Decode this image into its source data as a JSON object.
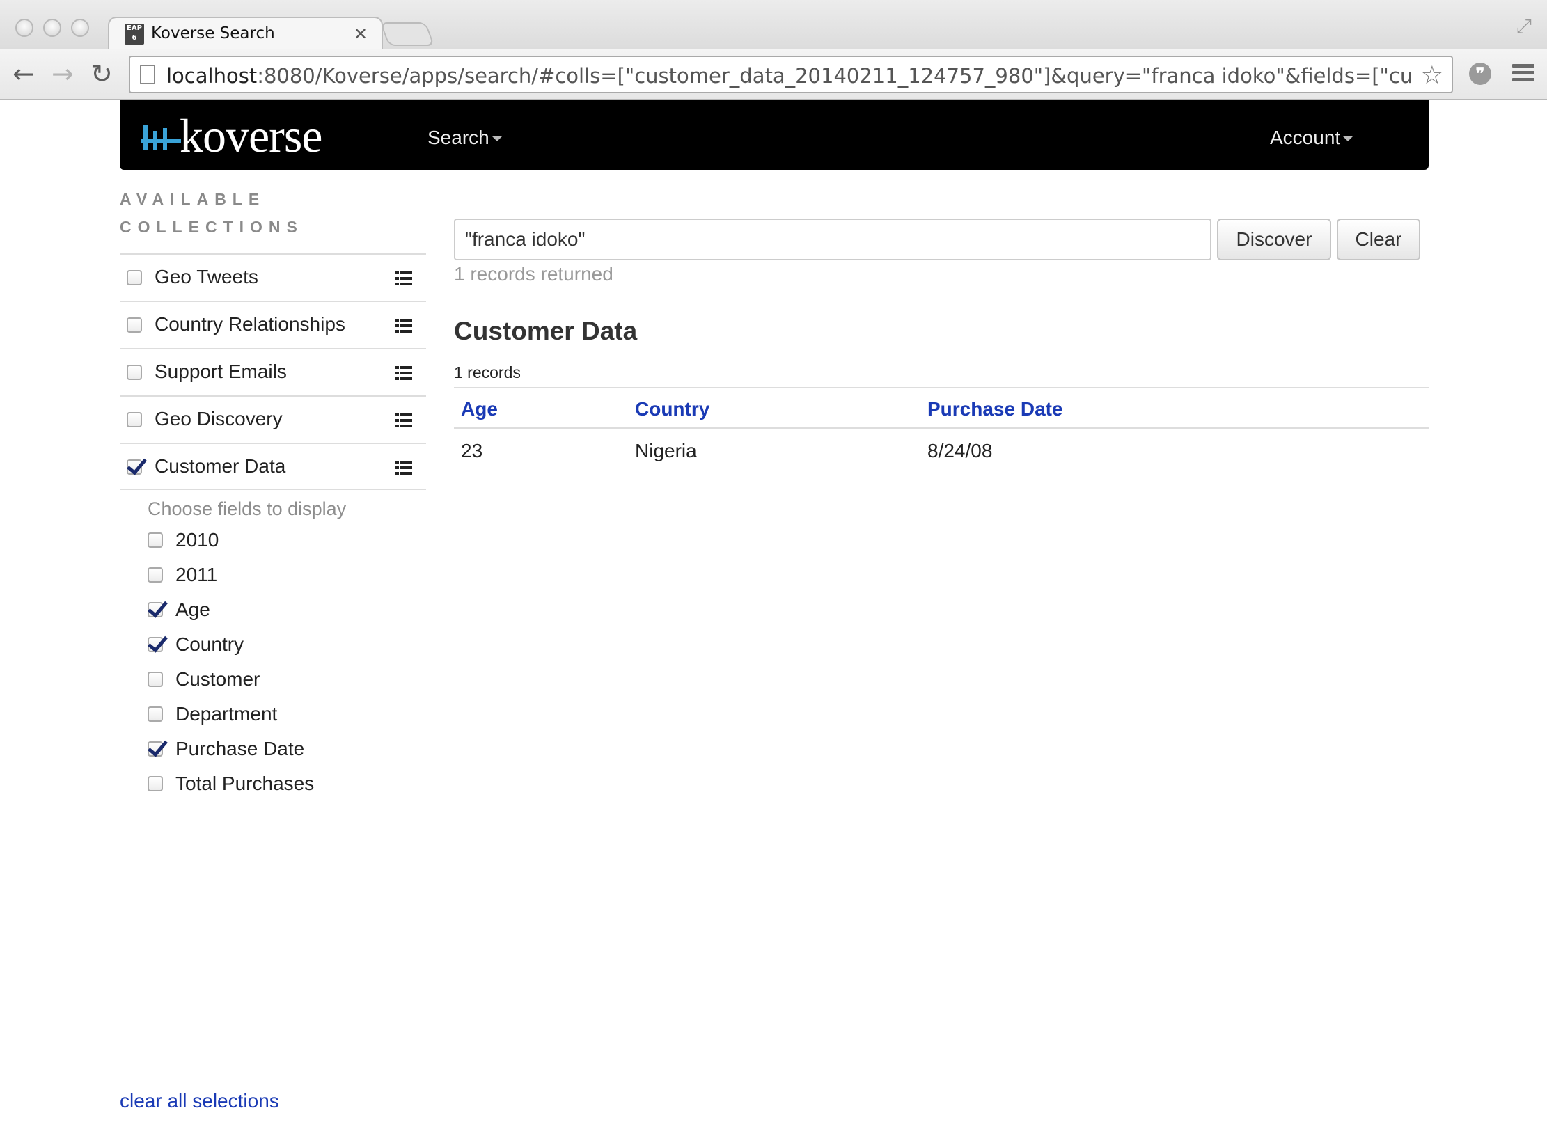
{
  "browser": {
    "tab_title": "Koverse Search",
    "tab_favicon_text": "EAP 6",
    "url_host": "localhost",
    "url_rest": ":8080/Koverse/apps/search/#colls=[\"customer_data_20140211_124757_980\"]&query=\"franca idoko\"&fields=[\"custome..."
  },
  "header": {
    "logo_text": "koverse",
    "nav": {
      "search": "Search",
      "account": "Account"
    },
    "accent_color": "#3aa3d8"
  },
  "sidebar": {
    "heading_line1": "AVAILABLE",
    "heading_line2": "COLLECTIONS",
    "collections": [
      {
        "label": "Geo Tweets",
        "checked": false
      },
      {
        "label": "Country Relationships",
        "checked": false
      },
      {
        "label": "Support Emails",
        "checked": false
      },
      {
        "label": "Geo Discovery",
        "checked": false
      },
      {
        "label": "Customer Data",
        "checked": true
      }
    ],
    "fields_title": "Choose fields to display",
    "fields": [
      {
        "label": "2010",
        "checked": false
      },
      {
        "label": "2011",
        "checked": false
      },
      {
        "label": "Age",
        "checked": true
      },
      {
        "label": "Country",
        "checked": true
      },
      {
        "label": "Customer",
        "checked": false
      },
      {
        "label": "Department",
        "checked": false
      },
      {
        "label": "Purchase Date",
        "checked": true
      },
      {
        "label": "Total Purchases",
        "checked": false
      }
    ],
    "clear_all": "clear all selections"
  },
  "search": {
    "query": "\"franca idoko\"",
    "discover_label": "Discover",
    "clear_label": "Clear",
    "records_returned": "1 records returned"
  },
  "results": {
    "title": "Customer Data",
    "count": "1 records",
    "columns": [
      "Age",
      "Country",
      "Purchase Date"
    ],
    "rows": [
      [
        "23",
        "Nigeria",
        "8/24/08"
      ]
    ]
  }
}
